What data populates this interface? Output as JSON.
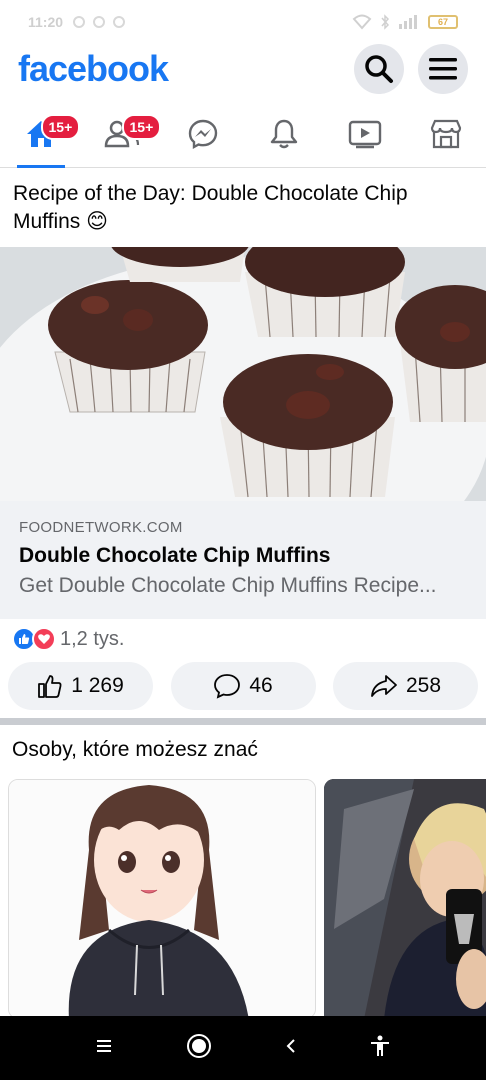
{
  "status_bar": {
    "time": "11:20",
    "battery": "67"
  },
  "header": {
    "logo": "facebook"
  },
  "nav": {
    "home_badge": "15+",
    "friends_badge": "15+"
  },
  "post": {
    "text": "Recipe of the Day: Double Chocolate Chip Muffins 😊",
    "link": {
      "domain": "FOODNETWORK.COM",
      "title": "Double Chocolate Chip Muffins",
      "description": "Get Double Chocolate Chip Muffins Recipe..."
    },
    "reactions_count": "1,2 tys.",
    "actions": {
      "like_count": "1 269",
      "comment_count": "46",
      "share_count": "258"
    }
  },
  "pymk": {
    "title": "Osoby, które możesz znać"
  },
  "colors": {
    "brand": "#1877f2",
    "badge": "#e41e3f",
    "love": "#f33e58"
  }
}
